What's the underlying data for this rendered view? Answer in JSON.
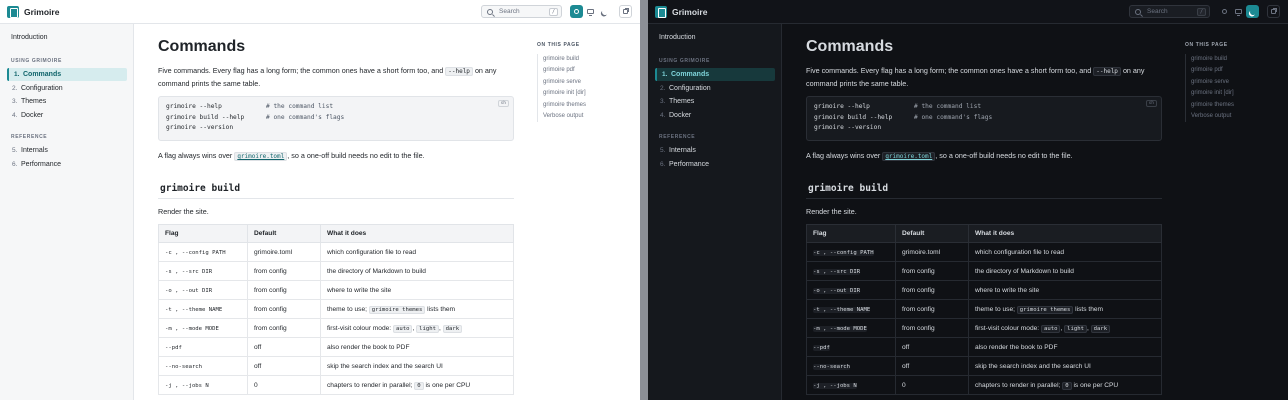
{
  "header": {
    "brand": "Grimoire",
    "search_placeholder": "Search",
    "search_shortcut": "/",
    "theme_buttons": [
      "sun-icon",
      "monitor-icon",
      "moon-icon"
    ],
    "external_icon": "external-link-icon"
  },
  "sidebar": {
    "intro": "Introduction",
    "sections": [
      {
        "title": "USING GRIMOIRE",
        "items": [
          {
            "num": "1.",
            "label": "Commands"
          },
          {
            "num": "2.",
            "label": "Configuration"
          },
          {
            "num": "3.",
            "label": "Themes"
          },
          {
            "num": "4.",
            "label": "Docker"
          }
        ]
      },
      {
        "title": "REFERENCE",
        "items": [
          {
            "num": "5.",
            "label": "Internals"
          },
          {
            "num": "6.",
            "label": "Performance"
          }
        ]
      }
    ]
  },
  "main": {
    "title": "Commands",
    "lead_a": "Five commands. Every flag has a long form; the common ones have a short form too, and",
    "lead_code": "--help",
    "lead_b": "on any command prints the same table.",
    "code_lang": "sh",
    "code_lines": [
      {
        "cmd": "grimoire --help",
        "comment": "# the command list"
      },
      {
        "cmd": "grimoire build --help",
        "comment": "# one command's flags"
      },
      {
        "cmd": "grimoire --version",
        "comment": ""
      }
    ],
    "para2_a": "A flag always wins over",
    "para2_code": "grimoire.toml",
    "para2_b": ", so a one-off build needs no edit to the file.",
    "section_title": "grimoire build",
    "section_desc": "Render the site.",
    "table_headers": [
      "Flag",
      "Default",
      "What it does"
    ],
    "table_rows": [
      {
        "flag": "-c , --config PATH",
        "default": "grimoire.toml",
        "desc": "which configuration file to read"
      },
      {
        "flag": "-s , --src DIR",
        "default": "from config",
        "desc": "the directory of Markdown to build"
      },
      {
        "flag": "-o , --out DIR",
        "default": "from config",
        "desc": "where to write the site"
      },
      {
        "flag": "-t , --theme NAME",
        "default": "from config",
        "desc_a": "theme to use;",
        "desc_code": "grimoire themes",
        "desc_b": "lists them"
      },
      {
        "flag": "-m , --mode MODE",
        "default": "from config",
        "desc_a": "first-visit colour mode:",
        "desc_codes": [
          "auto",
          "light",
          "dark"
        ]
      },
      {
        "flag": "--pdf",
        "default": "off",
        "desc": "also render the book to PDF"
      },
      {
        "flag": "--no-search",
        "default": "off",
        "desc": "skip the search index and the search UI"
      },
      {
        "flag": "-j , --jobs N",
        "default": "0",
        "desc_a": "chapters to render in parallel;",
        "desc_code": "0",
        "desc_b": "is one per CPU"
      }
    ]
  },
  "toc": {
    "title": "ON THIS PAGE",
    "items": [
      "grimoire build",
      "grimoire pdf",
      "grimoire serve",
      "grimoire init [dir]",
      "grimoire themes",
      "Verbose output"
    ]
  },
  "colors": {
    "accent": "#1c8a93",
    "light_bg": "#ffffff",
    "dark_bg": "#0f1115"
  }
}
